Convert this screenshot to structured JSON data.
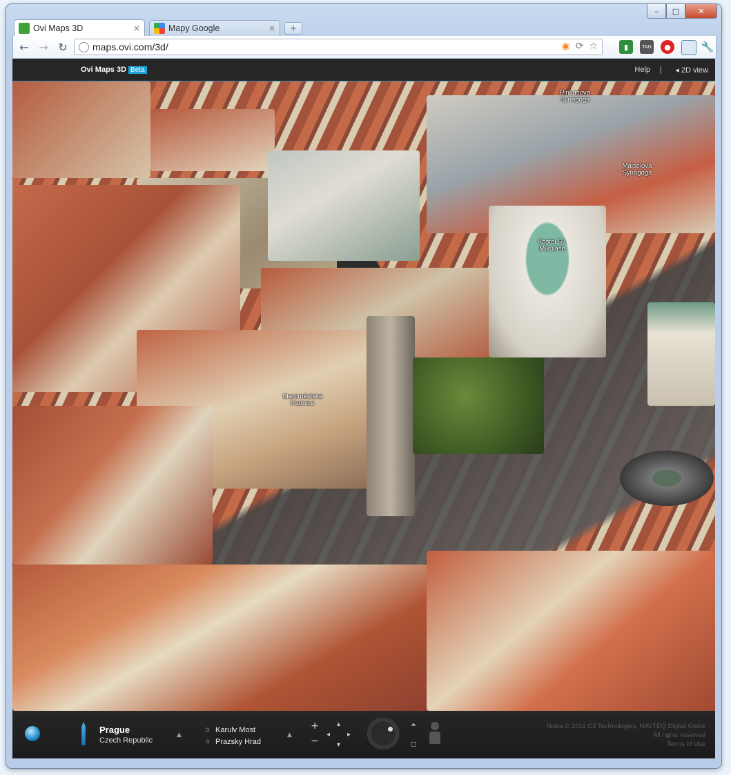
{
  "window": {
    "controls": [
      "–",
      "□",
      "✕"
    ]
  },
  "browser": {
    "tabs": [
      {
        "label": "Ovi Maps 3D",
        "close": "×",
        "active": true
      },
      {
        "label": "Mapy Google",
        "close": "×",
        "active": false
      }
    ],
    "new_tab": "+",
    "address": "maps.ovi.com/3d/",
    "nav": {
      "back": "←",
      "forward": "→",
      "reload": "↻"
    },
    "extensions": [
      "rss-icon",
      "refresh-icon",
      "star-icon",
      "green-ext-icon",
      "tag-ext-icon",
      "red-ext-icon",
      "window-ext-icon",
      "wrench-icon"
    ]
  },
  "app": {
    "brand": "Ovi Maps 3D",
    "beta": "Beta",
    "help": "Help",
    "separator": "|",
    "view_toggle": "◂ 2D view"
  },
  "map": {
    "labels": [
      {
        "name": "Pinkasova Synagoga"
      },
      {
        "name": "Maiselova Synagoga"
      },
      {
        "name": "Kostel Sv. Mikuláše"
      },
      {
        "name": "Staroměstská Radnice"
      }
    ]
  },
  "bottom": {
    "city": "Prague",
    "country": "Czech Republic",
    "nearby": [
      {
        "label": "Karulv Most"
      },
      {
        "label": "Prazsky Hrad"
      }
    ],
    "zoom_in": "+",
    "zoom_out": "−",
    "copyright": "Nokia © 2011 C3 Technologies, NAVTEQ Digital Globe",
    "privacy": "All rights reserved",
    "terms": "Terms of Use"
  },
  "colors": {
    "accent": "#1aa2d8",
    "bar": "#262626",
    "roof": "#c46a48"
  }
}
